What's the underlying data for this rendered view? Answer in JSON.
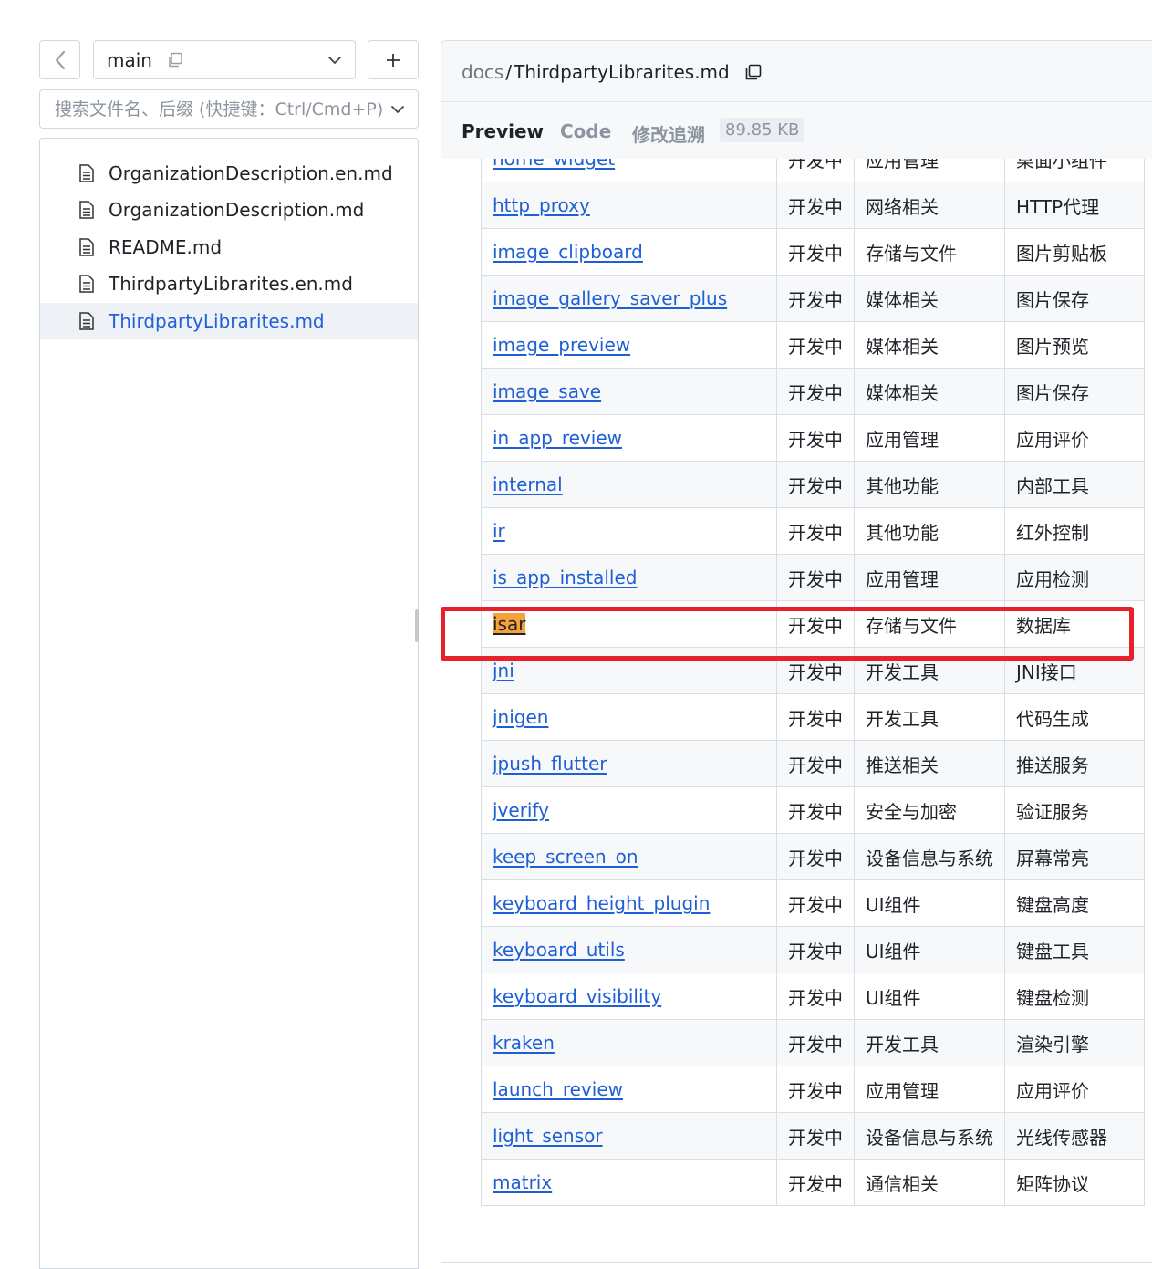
{
  "branch": {
    "name": "main"
  },
  "search": {
    "placeholder": "搜索文件名、后缀 (快捷键：Ctrl/Cmd+P)"
  },
  "file_tree": [
    {
      "name": "OrganizationDescription.en.md",
      "active": false
    },
    {
      "name": "OrganizationDescription.md",
      "active": false
    },
    {
      "name": "README.md",
      "active": false
    },
    {
      "name": "ThirdpartyLibrarites.en.md",
      "active": false
    },
    {
      "name": "ThirdpartyLibrarites.md",
      "active": true
    }
  ],
  "breadcrumb": {
    "dir": "docs",
    "separator": "/",
    "file": "ThirdpartyLibrarites.md"
  },
  "tabs": {
    "preview": "Preview",
    "code": "Code",
    "blame": "修改追溯",
    "size": "89.85 KB"
  },
  "table_rows": [
    {
      "name": "home_widget",
      "status": "开发中",
      "category": "应用管理",
      "desc": "桌面小组件"
    },
    {
      "name": "http_proxy",
      "status": "开发中",
      "category": "网络相关",
      "desc": "HTTP代理"
    },
    {
      "name": "image_clipboard",
      "status": "开发中",
      "category": "存储与文件",
      "desc": "图片剪贴板"
    },
    {
      "name": "image_gallery_saver_plus",
      "status": "开发中",
      "category": "媒体相关",
      "desc": "图片保存"
    },
    {
      "name": "image_preview",
      "status": "开发中",
      "category": "媒体相关",
      "desc": "图片预览"
    },
    {
      "name": "image_save",
      "status": "开发中",
      "category": "媒体相关",
      "desc": "图片保存"
    },
    {
      "name": "in_app_review",
      "status": "开发中",
      "category": "应用管理",
      "desc": "应用评价"
    },
    {
      "name": "internal",
      "status": "开发中",
      "category": "其他功能",
      "desc": "内部工具"
    },
    {
      "name": "ir",
      "status": "开发中",
      "category": "其他功能",
      "desc": "红外控制"
    },
    {
      "name": "is_app_installed",
      "status": "开发中",
      "category": "应用管理",
      "desc": "应用检测"
    },
    {
      "name": "isar",
      "status": "开发中",
      "category": "存储与文件",
      "desc": "数据库",
      "highlighted": true
    },
    {
      "name": "jni",
      "status": "开发中",
      "category": "开发工具",
      "desc": "JNI接口"
    },
    {
      "name": "jnigen",
      "status": "开发中",
      "category": "开发工具",
      "desc": "代码生成"
    },
    {
      "name": "jpush_flutter",
      "status": "开发中",
      "category": "推送相关",
      "desc": "推送服务"
    },
    {
      "name": "jverify",
      "status": "开发中",
      "category": "安全与加密",
      "desc": "验证服务"
    },
    {
      "name": "keep_screen_on",
      "status": "开发中",
      "category": "设备信息与系统",
      "desc": "屏幕常亮"
    },
    {
      "name": "keyboard_height_plugin",
      "status": "开发中",
      "category": "UI组件",
      "desc": "键盘高度"
    },
    {
      "name": "keyboard_utils",
      "status": "开发中",
      "category": "UI组件",
      "desc": "键盘工具"
    },
    {
      "name": "keyboard_visibility",
      "status": "开发中",
      "category": "UI组件",
      "desc": "键盘检测"
    },
    {
      "name": "kraken",
      "status": "开发中",
      "category": "开发工具",
      "desc": "渲染引擎"
    },
    {
      "name": "launch_review",
      "status": "开发中",
      "category": "应用管理",
      "desc": "应用评价"
    },
    {
      "name": "light_sensor",
      "status": "开发中",
      "category": "设备信息与系统",
      "desc": "光线传感器"
    },
    {
      "name": "matrix",
      "status": "开发中",
      "category": "通信相关",
      "desc": "矩阵协议"
    }
  ],
  "colors": {
    "link": "#1f5fd6",
    "highlight_box": "#e8202a",
    "search_match": "#f6a13c",
    "active_file": "#1f62d9"
  }
}
